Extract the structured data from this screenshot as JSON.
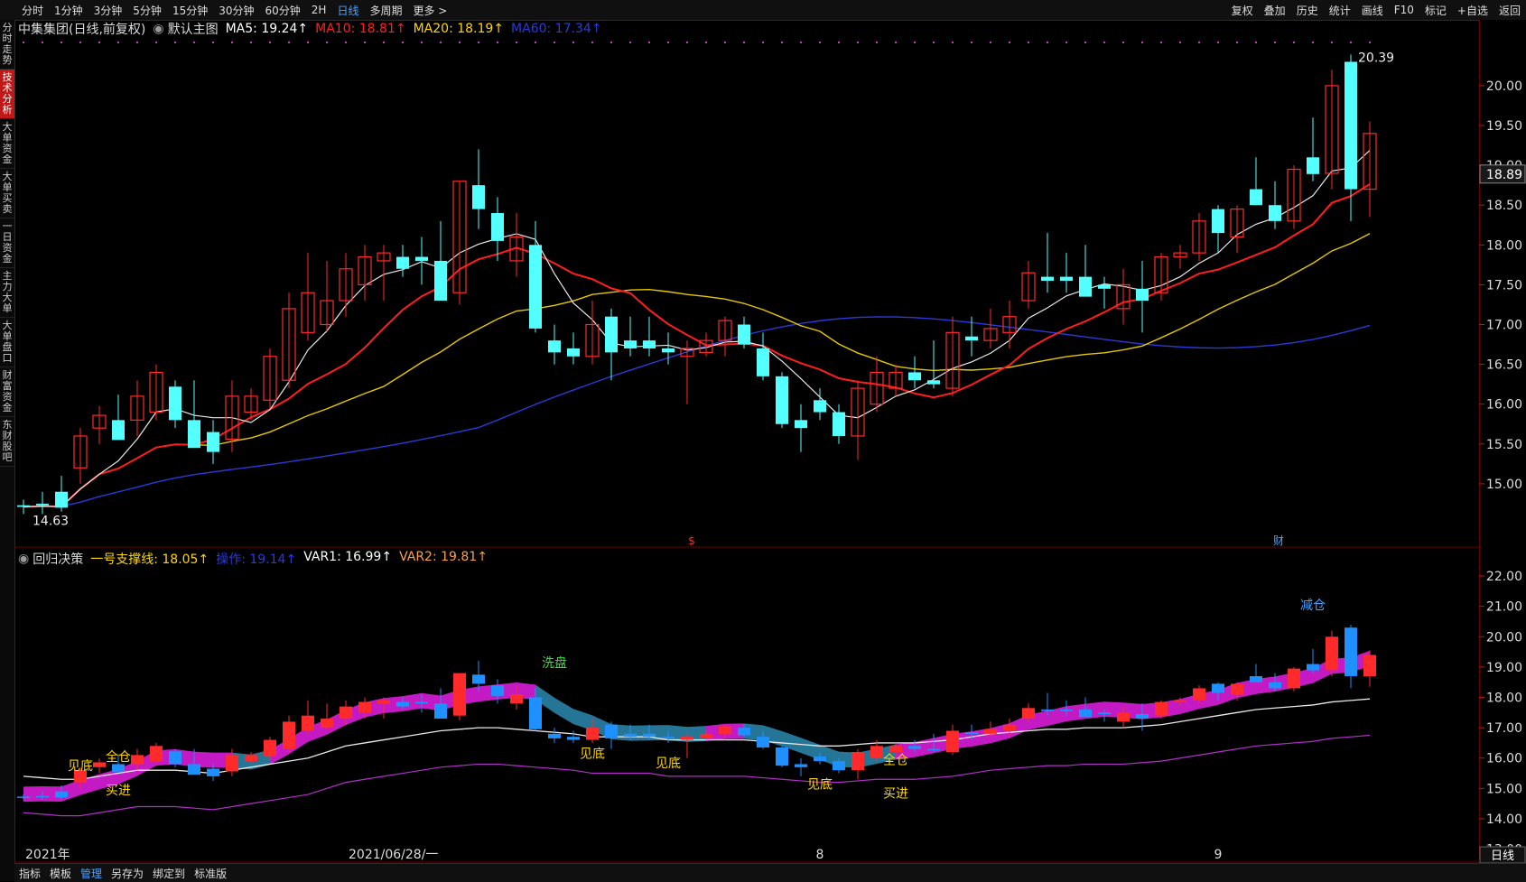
{
  "toolbar": {
    "periods": [
      "分时",
      "1分钟",
      "3分钟",
      "5分钟",
      "15分钟",
      "30分钟",
      "60分钟",
      "2H",
      "日线",
      "多周期",
      "更多 >"
    ],
    "active_period": "日线",
    "right_tools": [
      "复权",
      "叠加",
      "历史",
      "统计",
      "画线",
      "F10",
      "标记",
      "+自选",
      "返回"
    ]
  },
  "left_rail": [
    {
      "label": "分时走势",
      "active": false
    },
    {
      "label": "技术分析",
      "active": true
    },
    {
      "label": "大单资金",
      "active": false
    },
    {
      "label": "大单买卖",
      "active": false
    },
    {
      "label": "一日资金",
      "active": false
    },
    {
      "label": "主力大单",
      "active": false
    },
    {
      "label": "大单盘口",
      "active": false
    },
    {
      "label": "财富资金",
      "active": false
    },
    {
      "label": "东财股吧",
      "active": false
    }
  ],
  "main_panel": {
    "stock": "中集集团(日线,前复权)",
    "template": "默认主图",
    "indicators": [
      {
        "label": "MA5: 19.24↑",
        "color": "#ffffff"
      },
      {
        "label": "MA10: 18.81↑",
        "color": "#ff2020"
      },
      {
        "label": "MA20: 18.19↑",
        "color": "#ffd700"
      },
      {
        "label": "MA60: 17.34↑",
        "color": "#2a3bd8"
      }
    ],
    "high_label": "20.39",
    "low_label": "14.63",
    "current_price": "18.89",
    "markers": [
      "$",
      "财"
    ]
  },
  "sub_panel": {
    "name": "回归决策",
    "indicators": [
      {
        "label": "一号支撑线: 18.05↑",
        "color": "#ffd700"
      },
      {
        "label": "操作: 19.14↑",
        "color": "#2a3bd8"
      },
      {
        "label": "VAR1: 16.99↑",
        "color": "#ffffff"
      },
      {
        "label": "VAR2: 19.81↑",
        "color": "#ffa040"
      }
    ],
    "annotations": [
      "见底",
      "买进",
      "全仓",
      "洗盘",
      "见底",
      "见底",
      "见底",
      "全仓",
      "买进",
      "减仓"
    ]
  },
  "x_axis": {
    "labels": [
      "2021年",
      "2021/06/28/一",
      "8",
      "9"
    ]
  },
  "bottom_tabs": [
    "指标",
    "模板",
    "管理",
    "另存为",
    "绑定到",
    "标准版"
  ],
  "bottom_active_tab": "管理",
  "period_badge": "日线",
  "chart_data": [
    {
      "type": "candlestick",
      "title": "中集集团(日线,前复权)",
      "ylim": [
        14.5,
        20.6
      ],
      "yticks": [
        15.0,
        15.5,
        16.0,
        16.5,
        17.0,
        17.5,
        18.0,
        18.5,
        19.0,
        19.5,
        20.0
      ],
      "candles": [
        {
          "o": 14.73,
          "h": 14.8,
          "l": 14.62,
          "c": 14.71
        },
        {
          "o": 14.75,
          "h": 14.9,
          "l": 14.62,
          "c": 14.73
        },
        {
          "o": 14.9,
          "h": 15.1,
          "l": 14.65,
          "c": 14.7
        },
        {
          "o": 15.2,
          "h": 15.7,
          "l": 15.0,
          "c": 15.6
        },
        {
          "o": 15.7,
          "h": 15.98,
          "l": 15.5,
          "c": 15.86
        },
        {
          "o": 15.8,
          "h": 16.12,
          "l": 15.6,
          "c": 15.55
        },
        {
          "o": 15.8,
          "h": 16.3,
          "l": 15.6,
          "c": 16.1
        },
        {
          "o": 15.9,
          "h": 16.5,
          "l": 15.8,
          "c": 16.4
        },
        {
          "o": 16.22,
          "h": 16.3,
          "l": 15.7,
          "c": 15.8
        },
        {
          "o": 15.8,
          "h": 16.3,
          "l": 15.5,
          "c": 15.45
        },
        {
          "o": 15.65,
          "h": 15.8,
          "l": 15.25,
          "c": 15.4
        },
        {
          "o": 15.56,
          "h": 16.3,
          "l": 15.4,
          "c": 16.1
        },
        {
          "o": 15.9,
          "h": 16.2,
          "l": 15.8,
          "c": 16.1
        },
        {
          "o": 16.05,
          "h": 16.7,
          "l": 15.95,
          "c": 16.6
        },
        {
          "o": 16.3,
          "h": 17.4,
          "l": 16.2,
          "c": 17.2
        },
        {
          "o": 16.9,
          "h": 17.9,
          "l": 16.8,
          "c": 17.4
        },
        {
          "o": 17.0,
          "h": 17.8,
          "l": 16.9,
          "c": 17.3
        },
        {
          "o": 17.3,
          "h": 17.9,
          "l": 17.1,
          "c": 17.7
        },
        {
          "o": 17.5,
          "h": 18.0,
          "l": 17.3,
          "c": 17.85
        },
        {
          "o": 17.8,
          "h": 18.0,
          "l": 17.3,
          "c": 17.9
        },
        {
          "o": 17.85,
          "h": 18.0,
          "l": 17.6,
          "c": 17.7
        },
        {
          "o": 17.85,
          "h": 18.1,
          "l": 17.5,
          "c": 17.8
        },
        {
          "o": 17.8,
          "h": 18.3,
          "l": 17.4,
          "c": 17.3
        },
        {
          "o": 17.4,
          "h": 18.8,
          "l": 17.25,
          "c": 18.8
        },
        {
          "o": 18.75,
          "h": 19.2,
          "l": 18.2,
          "c": 18.45
        },
        {
          "o": 18.4,
          "h": 18.6,
          "l": 17.8,
          "c": 18.05
        },
        {
          "o": 17.8,
          "h": 18.4,
          "l": 17.6,
          "c": 18.1
        },
        {
          "o": 18.0,
          "h": 18.3,
          "l": 16.9,
          "c": 16.95
        },
        {
          "o": 16.8,
          "h": 17.0,
          "l": 16.5,
          "c": 16.65
        },
        {
          "o": 16.7,
          "h": 16.9,
          "l": 16.5,
          "c": 16.6
        },
        {
          "o": 16.6,
          "h": 17.3,
          "l": 16.5,
          "c": 17.0
        },
        {
          "o": 17.1,
          "h": 17.2,
          "l": 16.3,
          "c": 16.65
        },
        {
          "o": 16.8,
          "h": 17.1,
          "l": 16.6,
          "c": 16.7
        },
        {
          "o": 16.8,
          "h": 17.1,
          "l": 16.6,
          "c": 16.7
        },
        {
          "o": 16.7,
          "h": 16.9,
          "l": 16.5,
          "c": 16.65
        },
        {
          "o": 16.6,
          "h": 16.8,
          "l": 16.0,
          "c": 16.7
        },
        {
          "o": 16.65,
          "h": 16.9,
          "l": 16.6,
          "c": 16.8
        },
        {
          "o": 16.8,
          "h": 17.1,
          "l": 16.6,
          "c": 17.05
        },
        {
          "o": 17.0,
          "h": 17.1,
          "l": 16.7,
          "c": 16.75
        },
        {
          "o": 16.7,
          "h": 16.9,
          "l": 16.3,
          "c": 16.35
        },
        {
          "o": 16.35,
          "h": 16.4,
          "l": 15.7,
          "c": 15.75
        },
        {
          "o": 15.8,
          "h": 16.0,
          "l": 15.4,
          "c": 15.7
        },
        {
          "o": 16.05,
          "h": 16.2,
          "l": 15.8,
          "c": 15.9
        },
        {
          "o": 15.9,
          "h": 16.0,
          "l": 15.5,
          "c": 15.6
        },
        {
          "o": 15.6,
          "h": 16.3,
          "l": 15.3,
          "c": 16.2
        },
        {
          "o": 16.0,
          "h": 16.6,
          "l": 15.9,
          "c": 16.4
        },
        {
          "o": 16.2,
          "h": 16.5,
          "l": 16.1,
          "c": 16.4
        },
        {
          "o": 16.4,
          "h": 16.6,
          "l": 16.2,
          "c": 16.3
        },
        {
          "o": 16.3,
          "h": 16.8,
          "l": 16.2,
          "c": 16.25
        },
        {
          "o": 16.2,
          "h": 17.1,
          "l": 16.1,
          "c": 16.9
        },
        {
          "o": 16.85,
          "h": 17.1,
          "l": 16.6,
          "c": 16.8
        },
        {
          "o": 16.8,
          "h": 17.2,
          "l": 16.7,
          "c": 16.95
        },
        {
          "o": 16.9,
          "h": 17.3,
          "l": 16.7,
          "c": 17.1
        },
        {
          "o": 17.3,
          "h": 17.8,
          "l": 17.2,
          "c": 17.65
        },
        {
          "o": 17.6,
          "h": 18.15,
          "l": 17.4,
          "c": 17.55
        },
        {
          "o": 17.6,
          "h": 17.9,
          "l": 17.4,
          "c": 17.55
        },
        {
          "o": 17.6,
          "h": 18.0,
          "l": 17.4,
          "c": 17.35
        },
        {
          "o": 17.5,
          "h": 17.6,
          "l": 17.2,
          "c": 17.45
        },
        {
          "o": 17.2,
          "h": 17.7,
          "l": 17.0,
          "c": 17.5
        },
        {
          "o": 17.45,
          "h": 17.8,
          "l": 16.9,
          "c": 17.3
        },
        {
          "o": 17.4,
          "h": 17.9,
          "l": 17.3,
          "c": 17.85
        },
        {
          "o": 17.85,
          "h": 18.0,
          "l": 17.7,
          "c": 17.9
        },
        {
          "o": 17.9,
          "h": 18.4,
          "l": 17.8,
          "c": 18.3
        },
        {
          "o": 18.45,
          "h": 18.5,
          "l": 17.9,
          "c": 18.15
        },
        {
          "o": 18.1,
          "h": 18.5,
          "l": 17.9,
          "c": 18.45
        },
        {
          "o": 18.7,
          "h": 19.1,
          "l": 18.5,
          "c": 18.5
        },
        {
          "o": 18.5,
          "h": 18.8,
          "l": 18.2,
          "c": 18.3
        },
        {
          "o": 18.3,
          "h": 19.0,
          "l": 18.2,
          "c": 18.95
        },
        {
          "o": 19.1,
          "h": 19.6,
          "l": 18.8,
          "c": 18.89
        },
        {
          "o": 18.9,
          "h": 20.2,
          "l": 18.7,
          "c": 20.0
        },
        {
          "o": 20.3,
          "h": 20.39,
          "l": 18.3,
          "c": 18.7
        },
        {
          "o": 18.7,
          "h": 19.55,
          "l": 18.35,
          "c": 19.4
        }
      ]
    },
    {
      "type": "line",
      "title": "回归决策",
      "ylim": [
        12.6,
        22.3
      ],
      "yticks": [
        13.0,
        14.0,
        15.0,
        16.0,
        17.0,
        18.0,
        19.0,
        20.0,
        21.0,
        22.0
      ],
      "series": [
        {
          "name": "VAR1",
          "values": [
            15.4,
            15.35,
            15.3,
            15.3,
            15.4,
            15.5,
            15.6,
            15.6,
            15.6,
            15.55,
            15.5,
            15.6,
            15.7,
            15.8,
            15.9,
            16.0,
            16.2,
            16.4,
            16.5,
            16.6,
            16.7,
            16.8,
            16.9,
            16.95,
            17.0,
            17.0,
            16.95,
            16.9,
            16.85,
            16.8,
            16.7,
            16.7,
            16.7,
            16.7,
            16.6,
            16.6,
            16.6,
            16.6,
            16.6,
            16.55,
            16.5,
            16.45,
            16.4,
            16.4,
            16.45,
            16.5,
            16.5,
            16.5,
            16.55,
            16.6,
            16.7,
            16.8,
            16.85,
            16.9,
            16.95,
            16.95,
            17.0,
            17.0,
            17.0,
            17.05,
            17.1,
            17.2,
            17.3,
            17.4,
            17.5,
            17.6,
            17.65,
            17.7,
            17.75,
            17.85,
            17.9,
            17.95
          ]
        }
      ]
    }
  ]
}
